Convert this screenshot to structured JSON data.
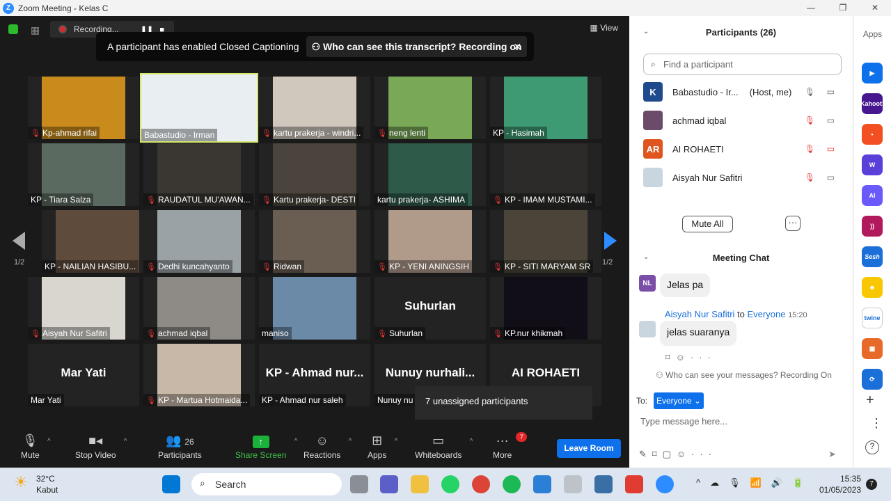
{
  "window": {
    "title": "Zoom Meeting - Kelas C"
  },
  "topbar": {
    "recording": "Recording...",
    "view": "View"
  },
  "caption": {
    "text": "A participant has enabled Closed Captioning",
    "who": "Who can see this transcript? Recording on"
  },
  "tiles": [
    {
      "name": "Kp-ahmad rifai",
      "muted": true,
      "video": true,
      "color": "#c98c1c"
    },
    {
      "name": "Babastudio - Irman",
      "muted": false,
      "video": true,
      "color": "#e9eef2",
      "active": true
    },
    {
      "name": "kartu prakerja - windri...",
      "muted": true,
      "video": true,
      "color": "#d0c7bd"
    },
    {
      "name": "neng lenti",
      "muted": true,
      "video": true,
      "color": "#79a857"
    },
    {
      "name": "KP - Hasimah",
      "muted": false,
      "video": true,
      "color": "#3d9a72"
    },
    {
      "name": "KP - Tiara Salza",
      "muted": false,
      "video": true,
      "color": "#5b6a60"
    },
    {
      "name": "RAUDATUL MU'AWAN...",
      "muted": true,
      "video": true,
      "color": "#3a3631"
    },
    {
      "name": "Kartu prakerja- DESTI",
      "muted": true,
      "video": true,
      "color": "#4b443c"
    },
    {
      "name": "kartu prakerja- ASHIMA",
      "muted": false,
      "video": true,
      "color": "#2e5a4a"
    },
    {
      "name": "KP - IMAM MUSTAMI...",
      "muted": true,
      "video": true,
      "color": "#2c2b2a"
    },
    {
      "name": "KP - NAILIAN HASIBU...",
      "muted": false,
      "video": true,
      "color": "#5f4b3b"
    },
    {
      "name": "Dedhi kuncahyanto",
      "muted": true,
      "video": true,
      "color": "#9aa2a6"
    },
    {
      "name": "Ridwan",
      "muted": true,
      "video": true,
      "color": "#6a5e52"
    },
    {
      "name": "KP - YENI ANINGSIH",
      "muted": true,
      "video": true,
      "color": "#b09a8a"
    },
    {
      "name": "KP - SITI MARYAM SR",
      "muted": true,
      "video": true,
      "color": "#4a4538"
    },
    {
      "name": "Aisyah Nur Safitri",
      "muted": true,
      "video": true,
      "color": "#d9d6cf"
    },
    {
      "name": "achmad iqbal",
      "muted": true,
      "video": true,
      "color": "#8e8a85"
    },
    {
      "name": "maniso",
      "muted": false,
      "video": true,
      "color": "#6a8aa8"
    },
    {
      "name": "Suhurlan",
      "muted": true,
      "video": false,
      "big": "Suhurlan"
    },
    {
      "name": "KP.nur khikmah",
      "muted": true,
      "video": true,
      "color": "#120e18"
    },
    {
      "name": "Mar Yati",
      "muted": false,
      "video": false,
      "big": "Mar Yati"
    },
    {
      "name": "KP - Martua Hotmaida...",
      "muted": true,
      "video": true,
      "color": "#c8b8a8"
    },
    {
      "name": "KP - Ahmad nur saleh",
      "muted": false,
      "video": false,
      "big": "KP - Ahmad nur..."
    },
    {
      "name": "Nunuy nu",
      "muted": false,
      "video": false,
      "big": "Nunuy nurhali..."
    },
    {
      "name": "",
      "muted": false,
      "video": false,
      "big": "AI ROHAETI"
    }
  ],
  "pager": {
    "left": "1/2",
    "right": "1/2"
  },
  "unassigned": "7 unassigned participants",
  "toolbar": {
    "mute": "Mute",
    "stop_video": "Stop Video",
    "participants": "Participants",
    "participants_count": "26",
    "share": "Share Screen",
    "reactions": "Reactions",
    "apps": "Apps",
    "whiteboards": "Whiteboards",
    "more": "More",
    "more_badge": "7",
    "leave": "Leave Room"
  },
  "participants": {
    "title": "Participants (26)",
    "search_placeholder": "Find a participant",
    "list": [
      {
        "name": "Babastudio - Ir...",
        "tag": "(Host, me)",
        "initials": "K",
        "color": "#1f4b8c"
      },
      {
        "name": "achmad iqbal",
        "tag": "",
        "initials": "",
        "color": "#6b4a6a"
      },
      {
        "name": "AI ROHAETI",
        "tag": "",
        "initials": "AR",
        "color": "#e0551f"
      },
      {
        "name": "Aisyah Nur Safitri",
        "tag": "",
        "initials": "",
        "color": "#c9d6e0"
      }
    ],
    "mute_all": "Mute All",
    "more": "···"
  },
  "chat": {
    "title": "Meeting Chat",
    "msg1": {
      "initials": "NL",
      "text": "Jelas pa"
    },
    "msg2": {
      "sender": "Aisyah Nur Safitri",
      "to": "to",
      "target": "Everyone",
      "time": "15:20",
      "text": "jelas suaranya"
    },
    "who_can_see": "Who can see your messages? Recording On",
    "to_label": "To:",
    "recipient": "Everyone",
    "placeholder": "Type message here..."
  },
  "apps_panel": {
    "title": "Apps",
    "items": [
      "Kahoot!",
      "Sesh",
      "twine"
    ]
  },
  "taskbar": {
    "temp": "32°C",
    "weather": "Kabut",
    "search": "Search",
    "time": "15:35",
    "date": "01/05/2023",
    "notif": "7"
  }
}
